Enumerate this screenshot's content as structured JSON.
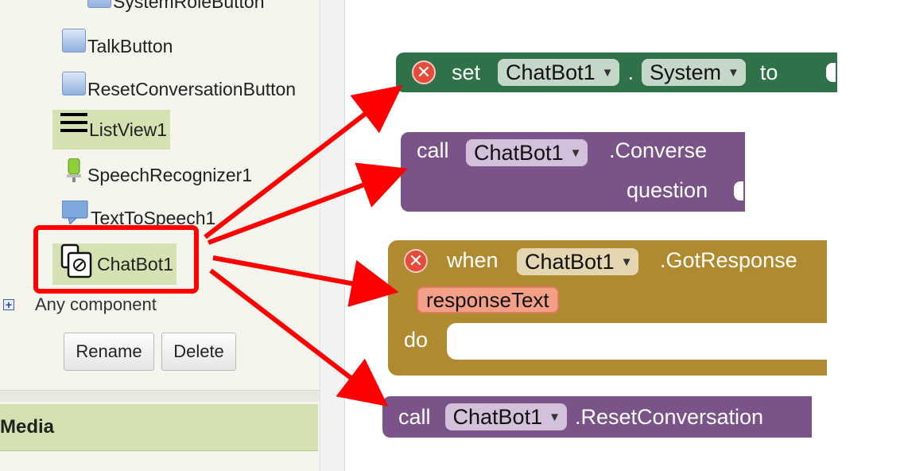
{
  "components_tree": {
    "items": [
      {
        "label": "SystemRoleButton",
        "icon": "button-icon"
      },
      {
        "label": "TalkButton",
        "icon": "button-icon"
      },
      {
        "label": "ResetConversationButton",
        "icon": "button-icon"
      },
      {
        "label": "ListView1",
        "icon": "listview-icon",
        "selected": true
      },
      {
        "label": "SpeechRecognizer1",
        "icon": "speech-recognizer-icon"
      },
      {
        "label": "TextToSpeech1",
        "icon": "text-to-speech-icon"
      },
      {
        "label": "ChatBot1",
        "icon": "chatbot-icon",
        "selected": true
      }
    ],
    "any_component_label": "Any component",
    "expand_symbol": "+"
  },
  "buttons": {
    "rename_label": "Rename",
    "delete_label": "Delete"
  },
  "media_section": {
    "title": "Media"
  },
  "blocks": {
    "set_block": {
      "keyword": "set",
      "component": "ChatBot1",
      "separator": ".",
      "property": "System",
      "to_keyword": "to",
      "color": "#2f7149"
    },
    "converse_block": {
      "keyword": "call",
      "component": "ChatBot1",
      "method": ".Converse",
      "param_label": "question",
      "color": "#7a5388"
    },
    "event_block": {
      "keyword": "when",
      "component": "ChatBot1",
      "event": ".GotResponse",
      "param": "responseText",
      "do_keyword": "do",
      "color": "#b08a2e"
    },
    "reset_block": {
      "keyword": "call",
      "component": "ChatBot1",
      "method": ".ResetConversation",
      "color": "#7a5388"
    }
  },
  "annotations": {
    "highlight_color": "#ff0000",
    "arrow_color": "#ff0000"
  }
}
